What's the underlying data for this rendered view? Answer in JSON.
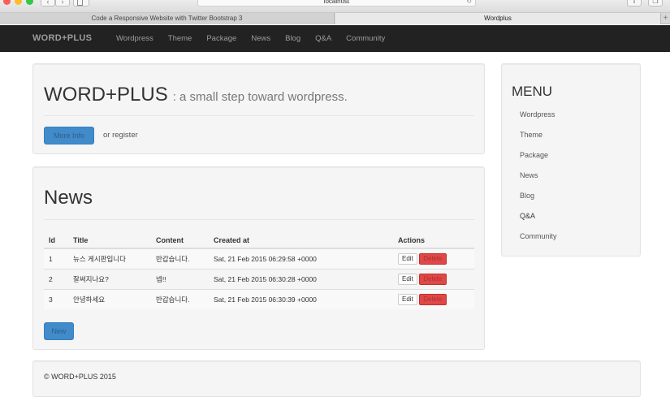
{
  "browser": {
    "address": "localhost",
    "tabs": [
      "Code a Responsive Website with Twitter Bootstrap 3",
      "Wordplus"
    ]
  },
  "navbar": {
    "brand": "WORD+PLUS",
    "items": [
      "Wordpress",
      "Theme",
      "Package",
      "News",
      "Blog",
      "Q&A",
      "Community"
    ]
  },
  "jumbotron": {
    "title": "WORD+PLUS",
    "subtitle": ": a small step toward wordpress.",
    "more_info": "More Info",
    "or_register": "or register"
  },
  "news": {
    "title": "News",
    "columns": [
      "Id",
      "Title",
      "Content",
      "Created at",
      "Actions"
    ],
    "rows": [
      {
        "id": "1",
        "title": "뉴스 게시판입니다",
        "content": "반갑습니다.",
        "created_at": "Sat, 21 Feb 2015 06:29:58 +0000"
      },
      {
        "id": "2",
        "title": "잘써지나요?",
        "content": "넵!!",
        "created_at": "Sat, 21 Feb 2015 06:30:28 +0000"
      },
      {
        "id": "3",
        "title": "안녕하세요",
        "content": "반갑습니다.",
        "created_at": "Sat, 21 Feb 2015 06:30:39 +0000"
      }
    ],
    "edit_label": "Edit",
    "delete_label": "Delete",
    "new_label": "New"
  },
  "menu": {
    "title": "MENU",
    "items": [
      "Wordpress",
      "Theme",
      "Package",
      "News",
      "Blog",
      "Q&A",
      "Community"
    ]
  },
  "footer": {
    "text": "© WORD+PLUS 2015"
  },
  "colors": {
    "navbar_bg": "#222222",
    "primary": "#428bca",
    "danger": "#e04848",
    "well_bg": "#f5f5f5"
  }
}
